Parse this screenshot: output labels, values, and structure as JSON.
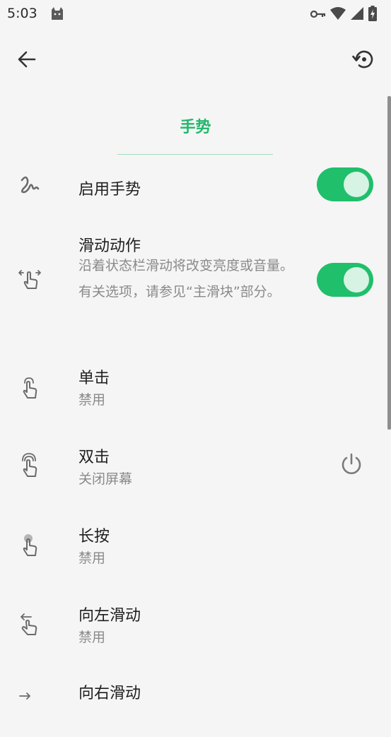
{
  "status_bar": {
    "time": "5:03",
    "icons": [
      "cat-icon",
      "key-icon",
      "wifi-icon",
      "signal-icon",
      "battery-charging-icon"
    ]
  },
  "toolbar": {
    "back_icon": "arrow-left-icon",
    "restore_icon": "restore-icon"
  },
  "section": {
    "title": "手势"
  },
  "rows": [
    {
      "icon": "squiggle-gesture-icon",
      "title": "启用手势",
      "toggle_on": true
    },
    {
      "icon": "swipe-horizontal-hand-icon",
      "title": "滑动动作",
      "description": "沿着状态栏滑动将改变亮度或音量。 有关选项，请参见“主滑块”部分。",
      "toggle_on": true
    },
    {
      "icon": "single-tap-hand-icon",
      "title": "单击",
      "subtitle": "禁用"
    },
    {
      "icon": "double-tap-hand-icon",
      "title": "双击",
      "subtitle": "关闭屏幕",
      "action_icon": "power-icon"
    },
    {
      "icon": "long-press-hand-icon",
      "title": "长按",
      "subtitle": "禁用"
    },
    {
      "icon": "swipe-left-hand-icon",
      "title": "向左滑动",
      "subtitle": "禁用"
    },
    {
      "icon": "swipe-right-hand-icon",
      "title": "向右滑动"
    }
  ],
  "colors": {
    "accent": "#20bf6b",
    "title_green": "#20b86a",
    "background": "#f5f5f5",
    "secondary_text": "#8a8a8a",
    "icon_gray": "#6b6b6b"
  }
}
